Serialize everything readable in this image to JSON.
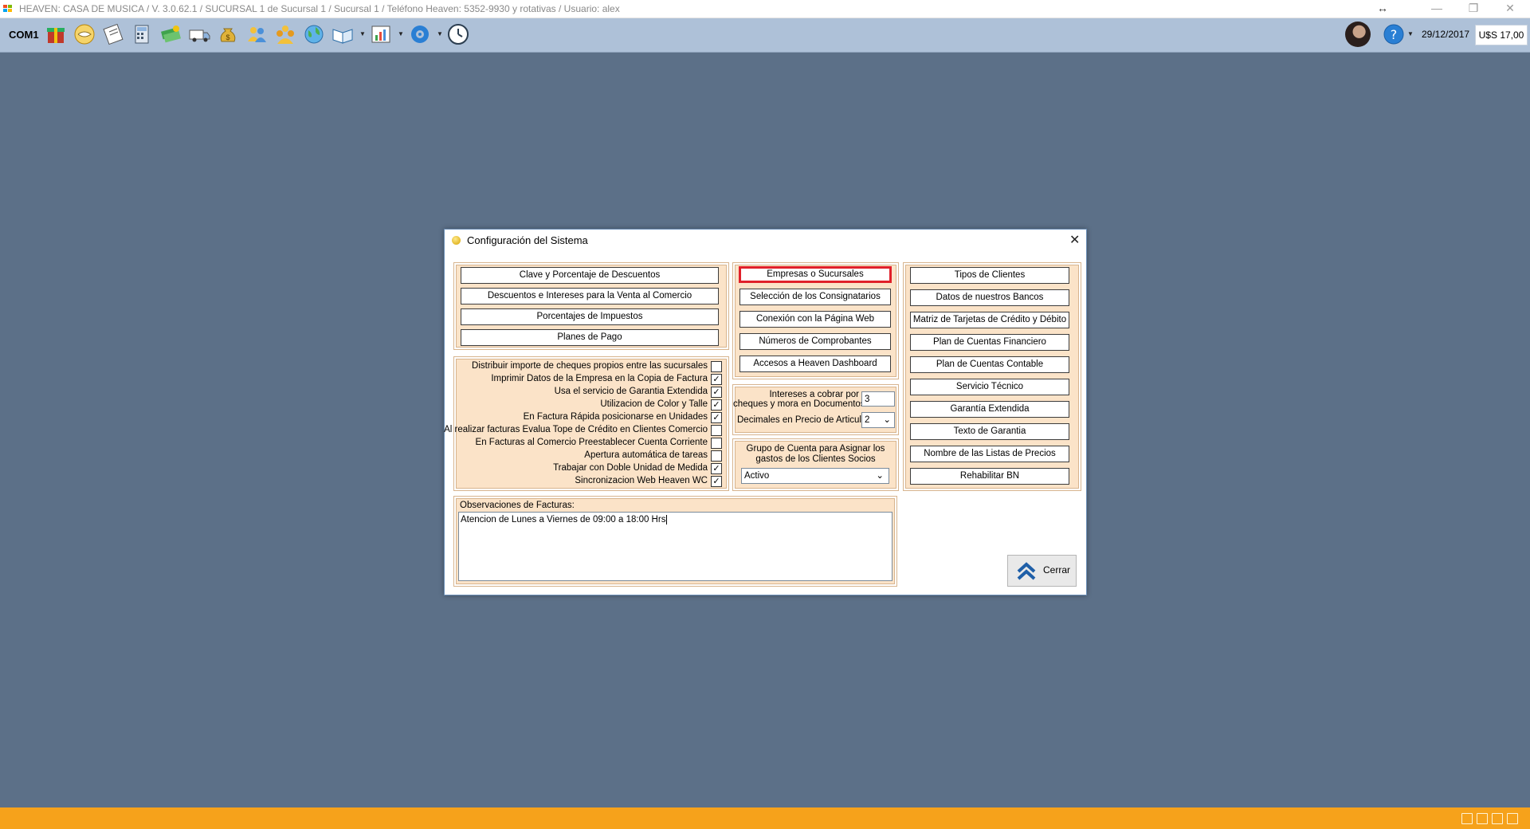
{
  "window": {
    "title": "HEAVEN: CASA DE MUSICA / V. 3.0.62.1 / SUCURSAL 1 de Sucursal 1 / Sucursal 1 / Teléfono Heaven: 5352-9930 y rotativas / Usuario: alex",
    "resize_icon": "↔",
    "minimize": "—",
    "restore": "❐",
    "close": "✕"
  },
  "toolbar": {
    "com_label": "COM1",
    "date": "29/12/2017",
    "exchange_rate": "U$S 17,00"
  },
  "dialog": {
    "title": "Configuración del Sistema",
    "close_glyph": "✕",
    "left_buttons": [
      "Clave y Porcentaje de Descuentos",
      "Descuentos e Intereses para la Venta al Comercio",
      "Porcentajes de Impuestos",
      "Planes de Pago"
    ],
    "middle_buttons": [
      "Empresas o Sucursales",
      "Selección de los Consignatarios",
      "Conexión con la Página Web",
      "Números de Comprobantes",
      "Accesos a Heaven Dashboard"
    ],
    "right_buttons": [
      "Tipos de Clientes",
      "Datos de nuestros Bancos",
      "Matriz de Tarjetas de Crédito y Débito",
      "Plan de Cuentas Financiero",
      "Plan de Cuentas Contable",
      "Servicio Técnico",
      "Garantía Extendida",
      "Texto de Garantia",
      "Nombre de las Listas de Precios",
      "Rehabilitar BN"
    ],
    "options": [
      {
        "label": "Distribuir importe de cheques propios entre las sucursales",
        "checked": false
      },
      {
        "label": "Imprimir Datos de la Empresa en la Copia de Factura",
        "checked": true
      },
      {
        "label": "Usa el servicio de Garantia Extendida",
        "checked": true
      },
      {
        "label": "Utilizacion de Color y Talle",
        "checked": true
      },
      {
        "label": "En Factura Rápida posicionarse en Unidades",
        "checked": true
      },
      {
        "label": "Al realizar facturas Evalua Tope de Crédito en Clientes Comercio",
        "checked": false
      },
      {
        "label": "En Facturas al Comercio Preestablecer Cuenta Corriente",
        "checked": false
      },
      {
        "label": "Apertura automática de tareas",
        "checked": false
      },
      {
        "label": "Trabajar con Doble Unidad de Medida",
        "checked": true
      },
      {
        "label": "Sincronizacion Web Heaven WC",
        "checked": true
      }
    ],
    "check_glyph": "✓",
    "interest": {
      "label_line1": "Intereses a cobrar por",
      "label_line2": "cheques y mora en Documentos",
      "value": "3"
    },
    "decimals": {
      "label": "Decimales en Precio de Articulos",
      "value": "2"
    },
    "account_group": {
      "label_line1": "Grupo de Cuenta para Asignar los",
      "label_line2": "gastos de los Clientes Socios",
      "value": "Activo"
    },
    "observations": {
      "label": "Observaciones de Facturas:",
      "value": "Atencion de Lunes a Viernes  de 09:00 a 18:00 Hrs"
    },
    "close_button_label": "Cerrar",
    "dropdown_glyph": "⌄"
  },
  "icons": [
    "gift-icon",
    "handshake-icon",
    "invoice-icon",
    "calculator-icon",
    "money-icon",
    "delivery-van-icon",
    "money-bag-icon",
    "users-icon",
    "clients-icon",
    "globe-icon",
    "book-icon",
    "chart-icon",
    "settings-icon",
    "clock-icon"
  ],
  "colors": {
    "desktop": "#5c7088",
    "toolbar": "#aec1d8",
    "statusbar": "#f6a21b",
    "panel": "#fbe3c8",
    "selected_border": "#e0202a"
  }
}
